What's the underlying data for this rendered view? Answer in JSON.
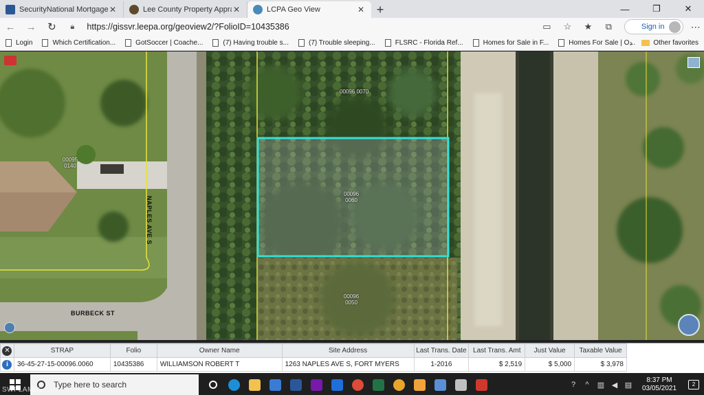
{
  "tabs": [
    {
      "title": "SecurityNational Mortgage Com",
      "favicon_color": "#2b5797"
    },
    {
      "title": "Lee County Property Appraiser",
      "favicon_color": "#5d4a2c"
    },
    {
      "title": "LCPA Geo View",
      "favicon_color": "#4a8ab8",
      "active": true
    }
  ],
  "address": {
    "url": "https://gissvr.leepa.org/geoview2/?FolioID=10435386"
  },
  "account": {
    "sign_in": "Sign in"
  },
  "favorites": [
    "Login",
    "Which Certification...",
    "GotSoccer | Coache...",
    "(7) Having trouble s...",
    "(7) Trouble sleeping...",
    "FLSRC - Florida Ref...",
    "Homes for Sale in F...",
    "Homes For Sale | O..."
  ],
  "other_favorites": "Other favorites",
  "map": {
    "parcels": [
      {
        "id": "00096 0070"
      },
      {
        "id": "00095 0140"
      },
      {
        "id": "00096 0060"
      },
      {
        "id": "00096 0050"
      }
    ],
    "streets": {
      "naples": "NAPLES AVE S",
      "burbeck": "BURBECK ST"
    },
    "selection_color": "#35e0d8"
  },
  "results": {
    "columns": [
      "STRAP",
      "Folio",
      "Owner Name",
      "Site Address",
      "Last Trans. Date",
      "Last Trans. Amt",
      "Just Value",
      "Taxable Value"
    ],
    "rows": [
      {
        "strap": "36-45-27-15-00096.0060",
        "folio": "10435386",
        "owner": "WILLIAMSON ROBERT T",
        "address": "1263 NAPLES AVE S, FORT MYERS",
        "date": "1-2016",
        "amount": "$ 2,519",
        "just": "$ 5,000",
        "taxable": "$ 3,978"
      }
    ]
  },
  "taskbar": {
    "search_placeholder": "Type here to search",
    "time": "8:37 PM",
    "date": "03/05/2021",
    "notifications": "2",
    "icons": [
      {
        "name": "task-view",
        "color": "#ffffff"
      },
      {
        "name": "edge",
        "color": "#1b8fd8"
      },
      {
        "name": "file-explorer",
        "color": "#f2c14e"
      },
      {
        "name": "store",
        "color": "#3a7bd5"
      },
      {
        "name": "word",
        "color": "#2b579a"
      },
      {
        "name": "onenote",
        "color": "#7719aa"
      },
      {
        "name": "mail",
        "color": "#1e6fd9"
      },
      {
        "name": "chrome",
        "color": "#dd4b39"
      },
      {
        "name": "excel",
        "color": "#217346"
      },
      {
        "name": "chrome-2",
        "color": "#e9a52b"
      },
      {
        "name": "notes",
        "color": "#f1a33a"
      },
      {
        "name": "document",
        "color": "#5a8fd6"
      },
      {
        "name": "paint",
        "color": "#c0c0c0"
      },
      {
        "name": "acrobat",
        "color": "#d0382b"
      }
    ]
  },
  "watermark": "SWFLAMLS"
}
